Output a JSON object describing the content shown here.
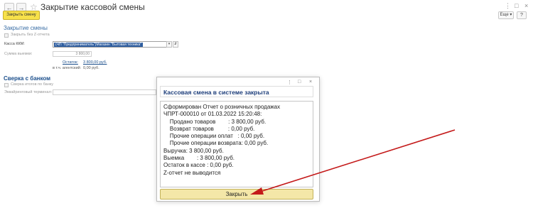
{
  "window": {
    "title": "Закрытие кассовой смены",
    "nav_back": "←",
    "nav_forward": "→",
    "star": "☆",
    "menu_dots": "⋮",
    "minimize": "□",
    "close": "×"
  },
  "toolbar": {
    "primary_button": "Закрыть смену",
    "more_button": "Еще ▾",
    "help_button": "?"
  },
  "form": {
    "section1_title": "Закрытие смены",
    "checkbox_no_z": "Закрыть без Z-отчета",
    "kkm_label": "Касса ККМ:",
    "kkm_value": "(ЧП \"Предприниматель\")Магазин \"Бытовая техника\"",
    "kkm_dropdown": "▾",
    "kkm_open": "⇵",
    "amount_label": "Сумма выемки:",
    "amount_value": "3 800,00",
    "balance_label": "Остаток:",
    "balance_value": "3 800,00 руб.",
    "agent_label": "в т.ч. агентский:",
    "agent_value": "0,00 руб.",
    "section2_title": "Сверка с банком",
    "checkbox_bank": "Сверка итогов по банку",
    "terminal_label": "Эквайринговый терминал:"
  },
  "modal": {
    "title": "Кассовая смена в системе закрыта",
    "menu_dots": "⋮",
    "maximize": "□",
    "close": "×",
    "lines": [
      "Сформирован Отчет о розничных продажах",
      "ЧПРТ-000010 от 01.03.2022 15:20:48:",
      "    Продано товаров        : 3 800,00 руб.",
      "    Возврат товаров         : 0,00 руб.",
      "    Прочие операции оплат   : 0,00 руб.",
      "    Прочие операции возврата: 0,00 руб.",
      "Выручка: 3 800,00 руб.",
      "Выемка        : 3 800,00 руб.",
      "Остаток в кассе : 0,00 руб.",
      "Z-отчет не выводится"
    ],
    "close_button": "Закрыть"
  },
  "colors": {
    "accent_yellow": "#f7e14a",
    "section_blue": "#3a6ea5",
    "arrow_red": "#c41a1a"
  }
}
